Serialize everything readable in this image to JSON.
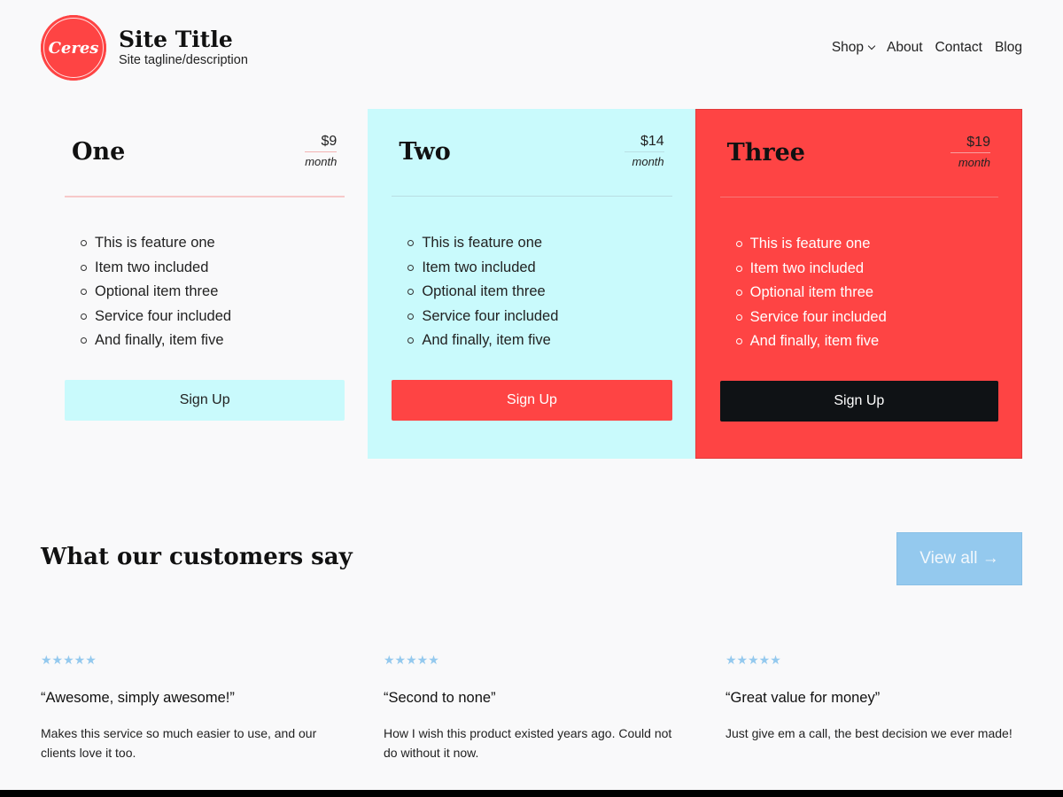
{
  "header": {
    "logo_text": "Ceres",
    "site_title": "Site Title",
    "tagline": "Site tagline/description",
    "nav": [
      {
        "label": "Shop",
        "has_dropdown": true
      },
      {
        "label": "About"
      },
      {
        "label": "Contact"
      },
      {
        "label": "Blog"
      }
    ]
  },
  "pricing": {
    "plans": [
      {
        "name": "One",
        "price": "$9",
        "period": "month",
        "features": [
          "This is feature one",
          "Item two included",
          "Optional item three",
          "Service four included",
          "And finally, item five"
        ],
        "button": "Sign Up"
      },
      {
        "name": "Two",
        "price": "$14",
        "period": "month",
        "features": [
          "This is feature one",
          "Item two included",
          "Optional item three",
          "Service four included",
          "And finally, item five"
        ],
        "button": "Sign Up"
      },
      {
        "name": "Three",
        "price": "$19",
        "period": "month",
        "features": [
          "This is feature one",
          "Item two included",
          "Optional item three",
          "Service four included",
          "And finally, item five"
        ],
        "button": "Sign Up"
      }
    ]
  },
  "testimonials": {
    "title": "What our customers say",
    "view_all": "View all →",
    "items": [
      {
        "stars": "★★★★★",
        "quote": "“Awesome, simply awesome!”",
        "text": "Makes this service so much easier to use, and our clients love it too."
      },
      {
        "stars": "★★★★★",
        "quote": "“Second to none”",
        "text": "How I wish this product existed years ago. Could not do without it now."
      },
      {
        "stars": "★★★★★",
        "quote": "“Great value for money”",
        "text": "Just give em a call, the best decision we ever made!"
      }
    ]
  },
  "colors": {
    "accent_red": "#fe4444",
    "accent_cyan": "#c9fafc",
    "accent_blue": "#94c9ee",
    "dark": "#0f1215"
  }
}
